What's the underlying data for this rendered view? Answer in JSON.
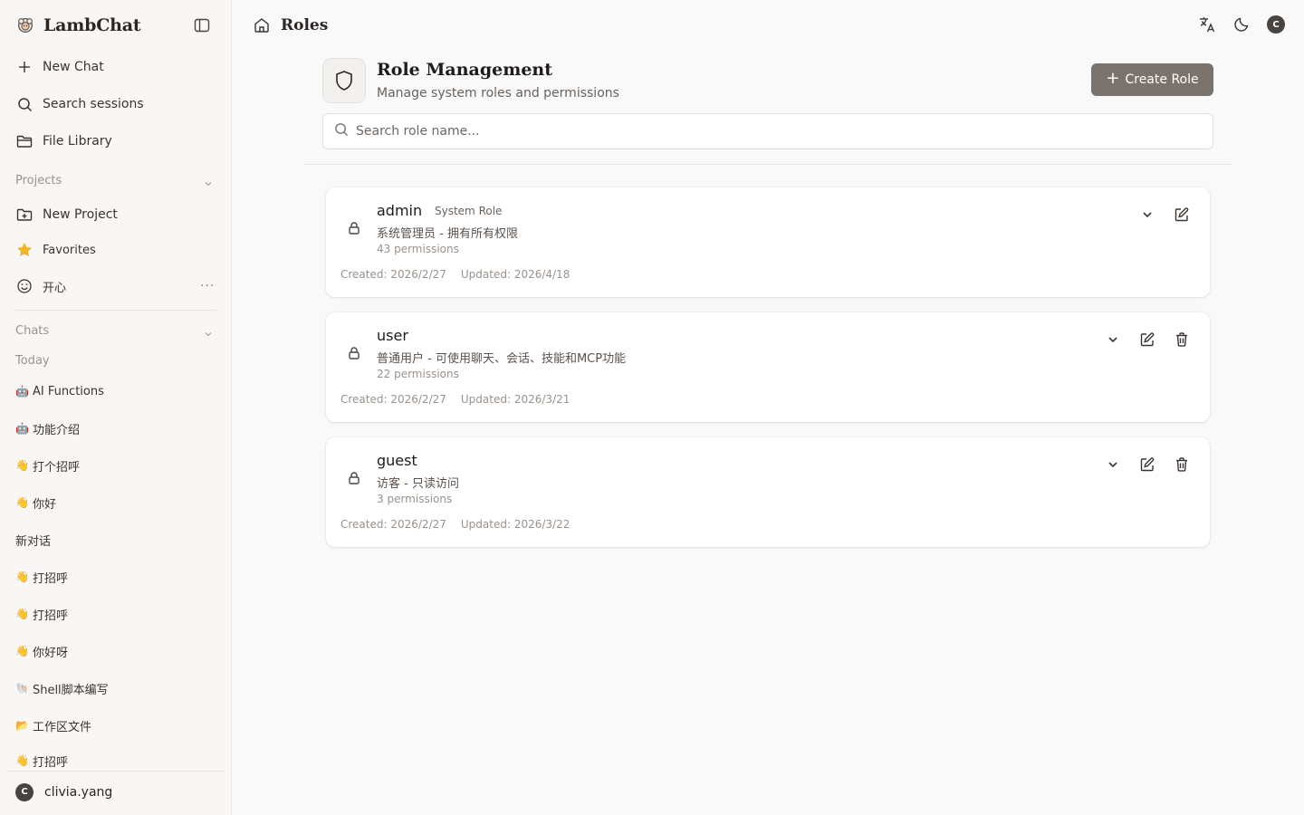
{
  "sidebar": {
    "brand": "LambChat",
    "nav": [
      {
        "label": "New Chat",
        "icon": "plus-icon"
      },
      {
        "label": "Search sessions",
        "icon": "search-icon"
      },
      {
        "label": "File Library",
        "icon": "folder-icon"
      }
    ],
    "projects_label": "Projects",
    "projects": [
      {
        "label": "New Project",
        "icon": "folder-plus-icon"
      },
      {
        "label": "Favorites",
        "icon": "star-icon"
      },
      {
        "label": "开心",
        "icon": "smile-icon"
      }
    ],
    "more": "···",
    "chats_label": "Chats",
    "today_label": "Today",
    "chats": [
      {
        "emoji": "🤖",
        "label": "AI Functions"
      },
      {
        "emoji": "🤖",
        "label": "功能介绍"
      },
      {
        "emoji": "👋",
        "label": "打个招呼"
      },
      {
        "emoji": "👋",
        "label": "你好"
      },
      {
        "emoji": "",
        "label": "新对话"
      },
      {
        "emoji": "👋",
        "label": "打招呼"
      },
      {
        "emoji": "👋",
        "label": "打招呼"
      },
      {
        "emoji": "👋",
        "label": "你好呀"
      },
      {
        "emoji": "🐚",
        "label": "Shell脚本编写"
      },
      {
        "emoji": "📂",
        "label": "工作区文件"
      },
      {
        "emoji": "👋",
        "label": "打招呼"
      }
    ],
    "user": {
      "initial": "C",
      "name": "clivia.yang"
    }
  },
  "header": {
    "title": "Roles",
    "avatar_initial": "C"
  },
  "main": {
    "title": "Role Management",
    "subtitle": "Manage system roles and permissions",
    "create_label": "Create Role",
    "search_placeholder": "Search role name...",
    "roles": [
      {
        "name": "admin",
        "badge": "System Role",
        "description": "系统管理员 - 拥有所有权限",
        "permissions": "43 permissions",
        "created": "Created: 2026/2/27",
        "updated": "Updated: 2026/4/18",
        "deletable": false
      },
      {
        "name": "user",
        "badge": "",
        "description": "普通用户 - 可使用聊天、会话、技能和MCP功能",
        "permissions": "22 permissions",
        "created": "Created: 2026/2/27",
        "updated": "Updated: 2026/3/21",
        "deletable": true
      },
      {
        "name": "guest",
        "badge": "",
        "description": "访客 - 只读访问",
        "permissions": "3 permissions",
        "created": "Created: 2026/2/27",
        "updated": "Updated: 2026/3/22",
        "deletable": true
      }
    ]
  }
}
